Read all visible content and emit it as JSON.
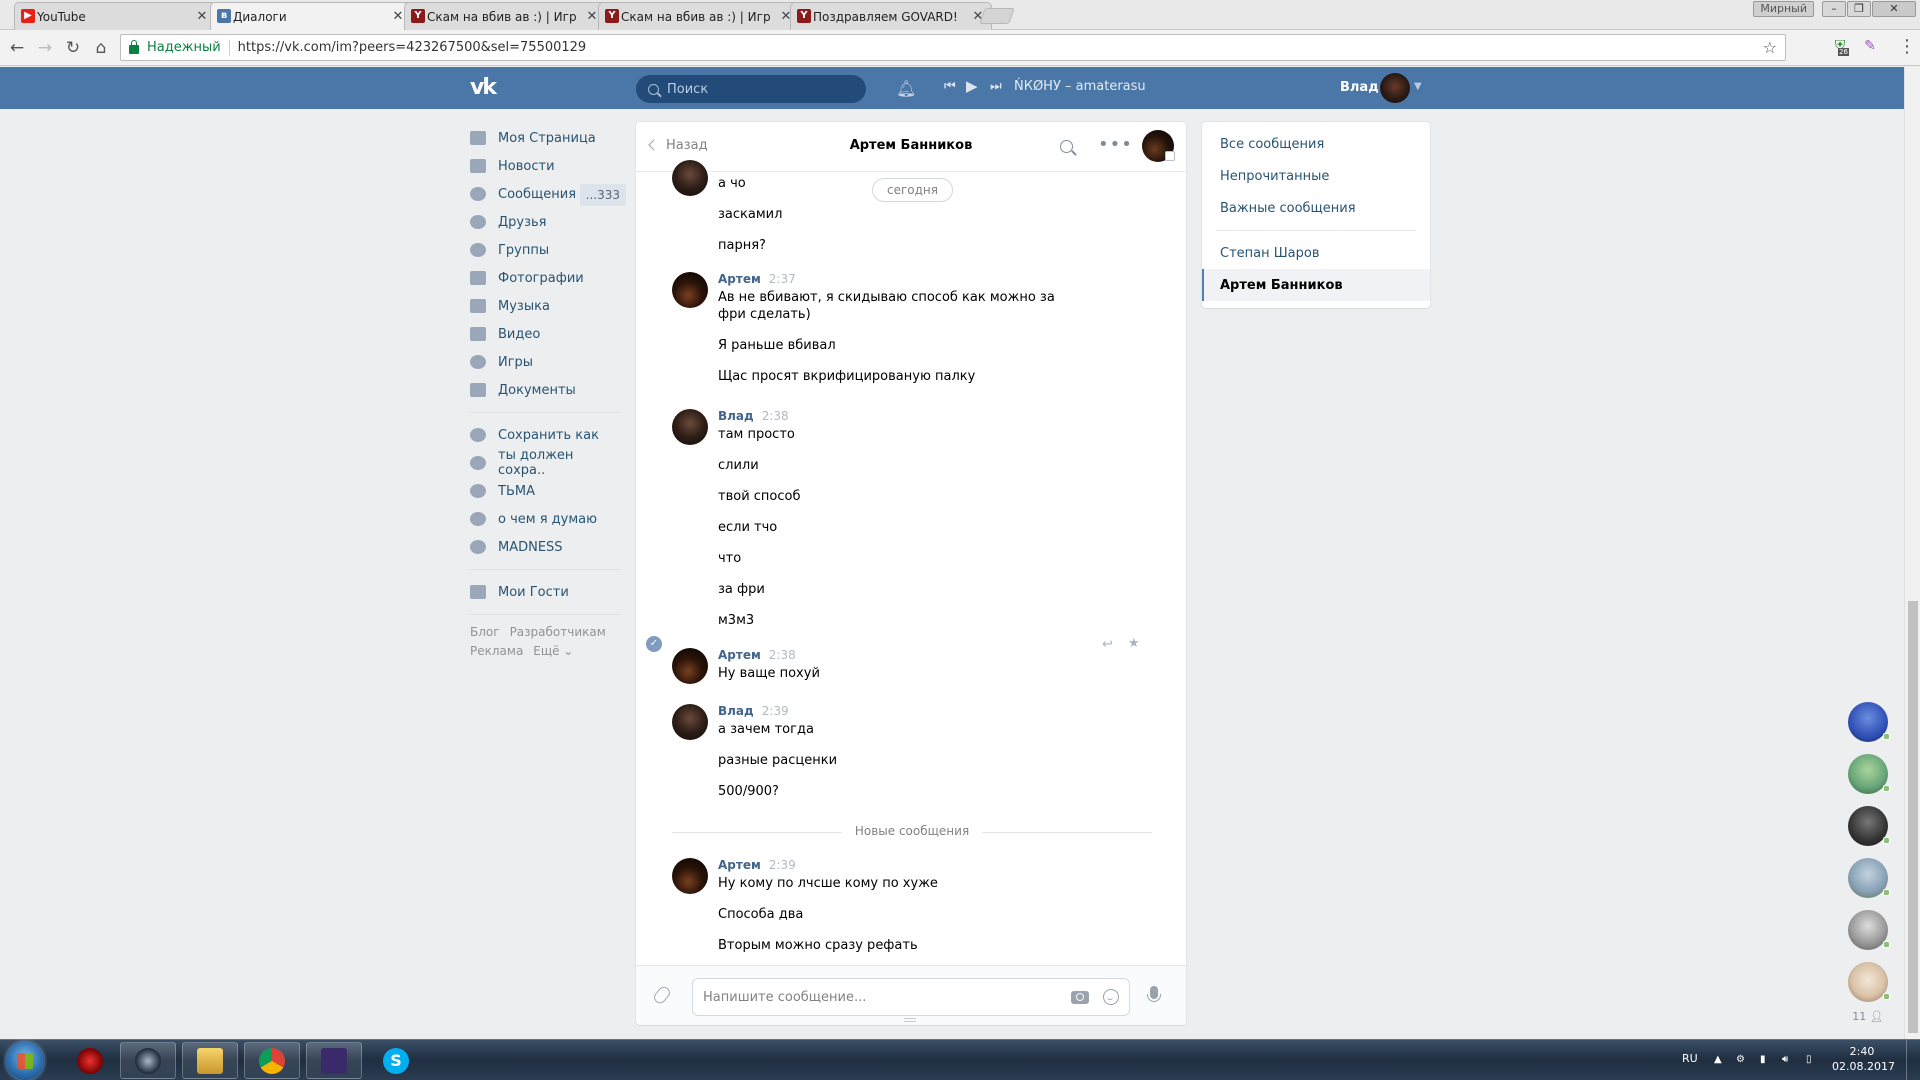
{
  "browser": {
    "tabs": [
      {
        "title": "YouTube",
        "favicon_color": "#e62117",
        "favicon_glyph": "▶"
      },
      {
        "title": "Диалоги",
        "favicon_color": "#4a76a8",
        "favicon_glyph": "в"
      },
      {
        "title": "Скам на вбив ав :) | Игр",
        "favicon_color": "#8b1a1a",
        "favicon_glyph": "Y"
      },
      {
        "title": "Скам на вбив ав :) | Игр",
        "favicon_color": "#8b1a1a",
        "favicon_glyph": "Y"
      },
      {
        "title": "Поздравляем GOVARD!",
        "favicon_color": "#8b1a1a",
        "favicon_glyph": "Y"
      }
    ],
    "profile_label": "Мирный",
    "secure_label": "Надежный",
    "url": "https://vk.com/im?peers=423267500&sel=75500129",
    "ext_badge": "26"
  },
  "header": {
    "logo": "vk",
    "search_placeholder": "Поиск",
    "track": "ŃКØНУ – amaterasu",
    "user_name": "Влад"
  },
  "left_menu": {
    "items": [
      {
        "label": "Моя Страница"
      },
      {
        "label": "Новости"
      },
      {
        "label": "Сообщения",
        "counter": "...333"
      },
      {
        "label": "Друзья"
      },
      {
        "label": "Группы"
      },
      {
        "label": "Фотографии"
      },
      {
        "label": "Музыка"
      },
      {
        "label": "Видео"
      },
      {
        "label": "Игры"
      },
      {
        "label": "Документы"
      }
    ],
    "groups": [
      {
        "label": "Сохранить как"
      },
      {
        "label": "ты должен сохра.."
      },
      {
        "label": "ТЬМА"
      },
      {
        "label": "о чем я думаю"
      },
      {
        "label": "MADNESS"
      }
    ],
    "apps": [
      {
        "label": "Мои Гости"
      }
    ],
    "footer": [
      "Блог",
      "Разработчикам",
      "Реклама",
      "Ещё ⌄"
    ]
  },
  "chat": {
    "back_label": "Назад",
    "peer_name": "Артем Банников",
    "date_pill": "сегодня",
    "first_lines": [
      "а чо",
      "заскамил",
      "парня?"
    ],
    "groups": [
      {
        "author": "Артем",
        "time": "2:37",
        "lines": [
          "Ав не вбивают, я скидываю способ как можно за фри сделать)",
          "Я раньше вбивал",
          "Щас просят вкрифицированую палку"
        ]
      },
      {
        "author": "Влад",
        "time": "2:38",
        "lines": [
          "там просто",
          "слили",
          "твой способ",
          "если тчо",
          "что",
          "за фри",
          "м3м3"
        ]
      },
      {
        "author": "Артем",
        "time": "2:38",
        "lines": [
          "Ну ваще похуй"
        ]
      },
      {
        "author": "Влад",
        "time": "2:39",
        "lines": [
          "а зачем тогда",
          "разные расценки",
          "500/900?"
        ]
      },
      {
        "author": "Артем",
        "time": "2:39",
        "lines": [
          "Ну кому по лчсше кому по хуже",
          "Способа два",
          "Вторым можно сразу рефать"
        ]
      }
    ],
    "new_messages_label": "Новые сообщения",
    "composer_placeholder": "Напишите сообщение..."
  },
  "right_panel": {
    "filters": [
      "Все сообщения",
      "Непрочитанные",
      "Важные сообщения"
    ],
    "dialogs": [
      "Степан Шаров",
      "Артем Банников"
    ]
  },
  "friends_strip": {
    "count": "11",
    "colors": [
      "#2f4fb4",
      "#6aa87a",
      "#333333",
      "#8aa3b8",
      "#9a9a9a",
      "#d9c2a8"
    ]
  },
  "taskbar": {
    "lang": "RU",
    "time": "2:40",
    "date": "02.08.2017"
  }
}
